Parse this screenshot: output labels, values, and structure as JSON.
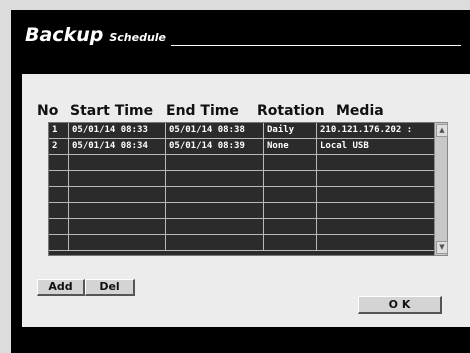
{
  "header": {
    "title": "Backup",
    "subtitle": "Schedule"
  },
  "table": {
    "columns": [
      "No",
      "Start Time",
      "End Time",
      "Rotation",
      "Media"
    ],
    "rows": [
      [
        "1",
        "05/01/14 08:33",
        "05/01/14 08:38",
        "Daily",
        "210.121.176.202 :"
      ],
      [
        "2",
        "05/01/14 08:34",
        "05/01/14 08:39",
        "None",
        "Local USB"
      ],
      [
        "",
        "",
        "",
        "",
        ""
      ],
      [
        "",
        "",
        "",
        "",
        ""
      ],
      [
        "",
        "",
        "",
        "",
        ""
      ],
      [
        "",
        "",
        "",
        "",
        ""
      ],
      [
        "",
        "",
        "",
        "",
        ""
      ],
      [
        "",
        "",
        "",
        "",
        ""
      ]
    ]
  },
  "scrollbar": {
    "up_icon": "arrow-up-icon",
    "down_icon": "arrow-down-icon"
  },
  "buttons": {
    "add_label": "Add",
    "del_label": "Del",
    "ok_label": "O K"
  }
}
